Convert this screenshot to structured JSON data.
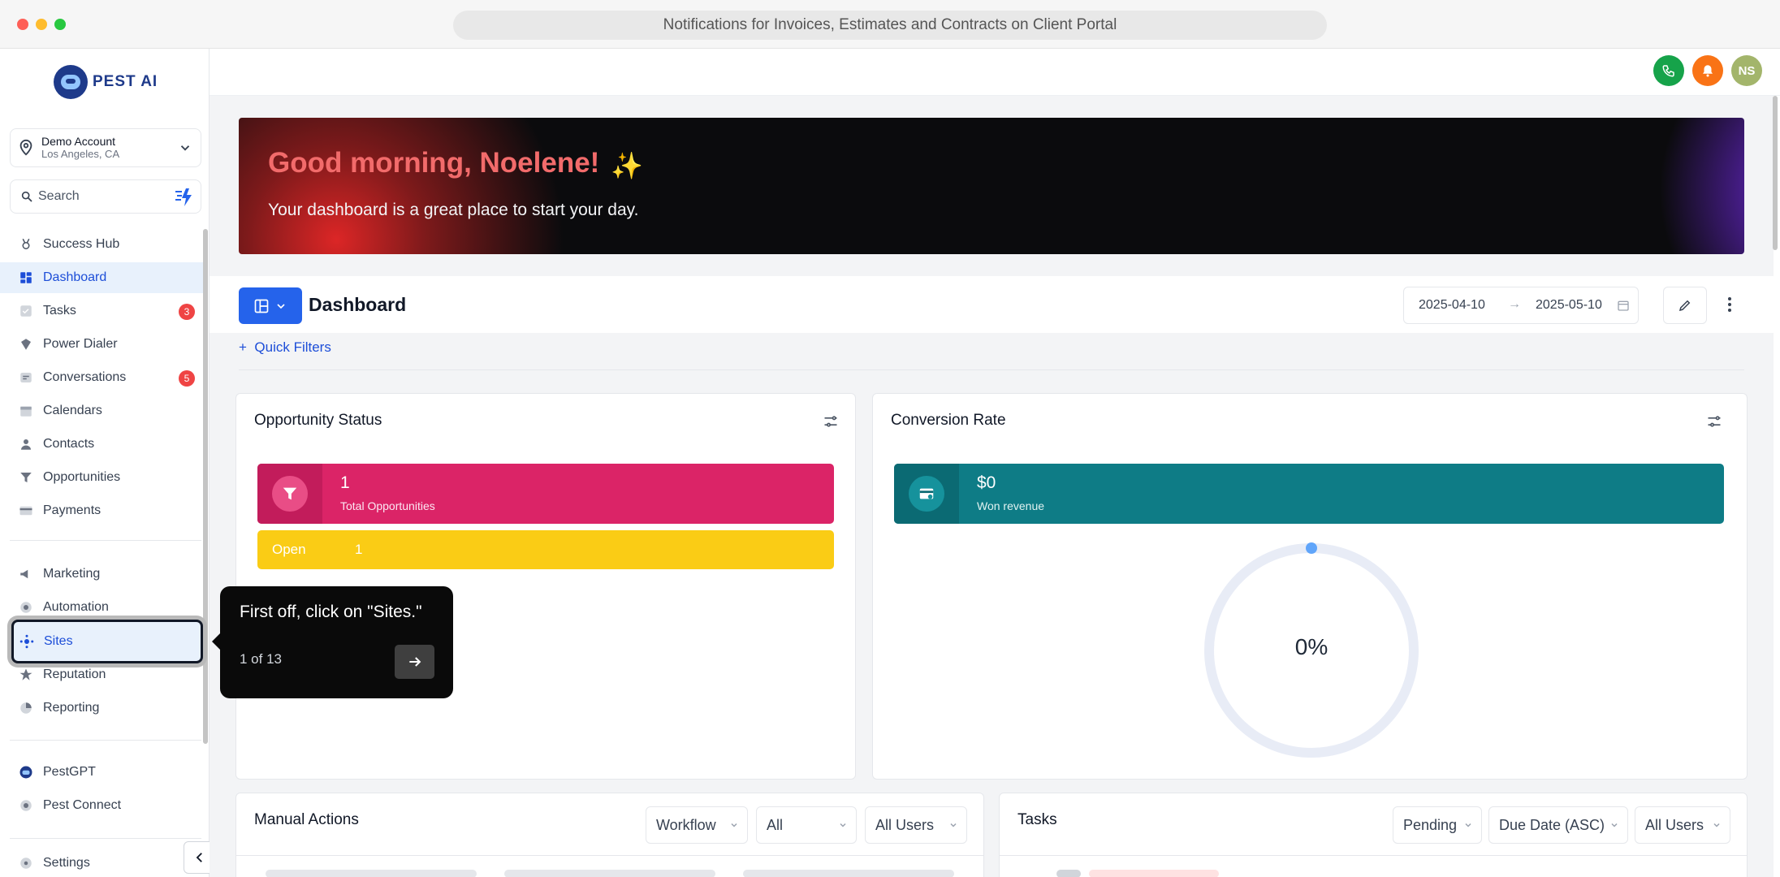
{
  "window": {
    "title": "Notifications for Invoices, Estimates and Contracts on Client Portal"
  },
  "brand": {
    "name": "PEST AI"
  },
  "account": {
    "name": "Demo Account",
    "location": "Los Angeles, CA"
  },
  "search": {
    "placeholder": "Search"
  },
  "sidebar": {
    "items": [
      {
        "label": "Success Hub",
        "icon": "trophy-icon"
      },
      {
        "label": "Dashboard",
        "icon": "dashboard-icon",
        "active": true
      },
      {
        "label": "Tasks",
        "icon": "checkbox-icon",
        "badge": "3"
      },
      {
        "label": "Power Dialer",
        "icon": "dialer-icon"
      },
      {
        "label": "Conversations",
        "icon": "chat-icon",
        "badge": "5"
      },
      {
        "label": "Calendars",
        "icon": "calendar-icon"
      },
      {
        "label": "Contacts",
        "icon": "person-icon"
      },
      {
        "label": "Opportunities",
        "icon": "funnel-icon"
      },
      {
        "label": "Payments",
        "icon": "card-icon"
      },
      {
        "label": "Marketing",
        "icon": "megaphone-icon"
      },
      {
        "label": "Automation",
        "icon": "automation-icon"
      },
      {
        "label": "Sites",
        "icon": "globe-icon",
        "highlighted": true
      },
      {
        "label": "Reputation",
        "icon": "star-icon"
      },
      {
        "label": "Reporting",
        "icon": "pie-chart-icon"
      },
      {
        "label": "PestGPT",
        "icon": "bot-icon"
      },
      {
        "label": "Pest Connect",
        "icon": "connect-icon"
      },
      {
        "label": "Settings",
        "icon": "gear-icon"
      }
    ]
  },
  "topbar": {
    "avatar_initials": "NS"
  },
  "hero": {
    "greeting": "Good morning, Noelene!",
    "sparkle": "✨",
    "subtitle": "Your dashboard is a great place to start your day."
  },
  "dashboard": {
    "title": "Dashboard",
    "date_from": "2025-04-10",
    "date_to": "2025-05-10",
    "quick_filters": "Quick Filters",
    "quick_filters_icon": "+"
  },
  "opportunity_status": {
    "title": "Opportunity Status",
    "total_value": "1",
    "total_label": "Total Opportunities",
    "open_label": "Open",
    "open_value": "1"
  },
  "conversion_rate": {
    "title": "Conversion Rate",
    "revenue_value": "$0",
    "revenue_label": "Won revenue",
    "rate_value": "0%",
    "rate_fraction": 0
  },
  "manual_actions": {
    "title": "Manual Actions",
    "filters": [
      "Workflow",
      "All",
      "All Users"
    ]
  },
  "tasks_card": {
    "title": "Tasks",
    "filters": [
      "Pending",
      "Due Date (ASC)",
      "All Users"
    ]
  },
  "tour": {
    "message": "First off, click on \"Sites.\"",
    "step": "1 of 13"
  },
  "colors": {
    "accent": "#2563eb",
    "opportunity_total": "#db2467",
    "opportunity_open": "#facc15",
    "won_revenue": "#0e7c86",
    "phone": "#16a34a",
    "bell": "#f97316"
  }
}
